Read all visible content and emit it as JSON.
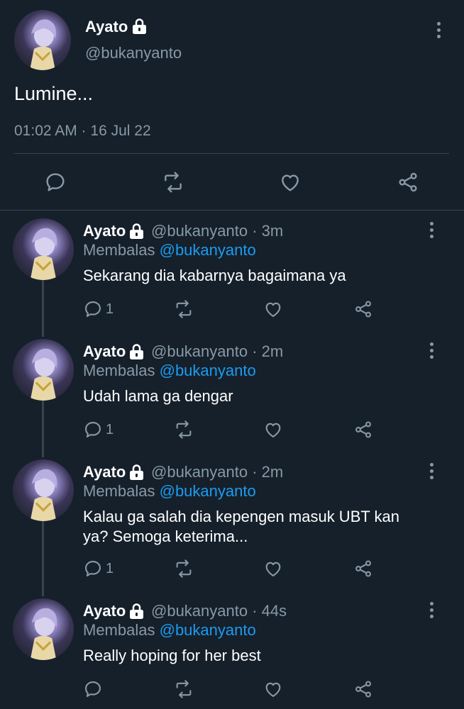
{
  "main_tweet": {
    "name": "Ayato",
    "handle": "@bukanyanto",
    "text": "Lumine...",
    "timestamp": "01:02 AM · 16 Jul 22"
  },
  "replies": [
    {
      "name": "Ayato",
      "meta": "@bukanyanto · 3m",
      "reply_prefix": "Membalas",
      "reply_to": "@bukanyanto",
      "text": "Sekarang dia kabarnya bagaimana ya",
      "reply_count": "1"
    },
    {
      "name": "Ayato",
      "meta": "@bukanyanto · 2m",
      "reply_prefix": "Membalas",
      "reply_to": "@bukanyanto",
      "text": "Udah lama ga dengar",
      "reply_count": "1"
    },
    {
      "name": "Ayato",
      "meta": "@bukanyanto · 2m",
      "reply_prefix": "Membalas",
      "reply_to": "@bukanyanto",
      "text": "Kalau ga salah dia kepengen masuk UBT kan ya? Semoga keterima...",
      "reply_count": "1"
    },
    {
      "name": "Ayato",
      "meta": "@bukanyanto · 44s",
      "reply_prefix": "Membalas",
      "reply_to": "@bukanyanto",
      "text": "Really hoping for her best",
      "reply_count": ""
    }
  ],
  "colors": {
    "background": "#15202b",
    "muted": "#8899a6",
    "link": "#1d9bf0",
    "divider": "#38444d"
  },
  "icons": [
    "lock-icon",
    "more-icon",
    "reply-icon",
    "retweet-icon",
    "like-icon",
    "share-icon"
  ]
}
